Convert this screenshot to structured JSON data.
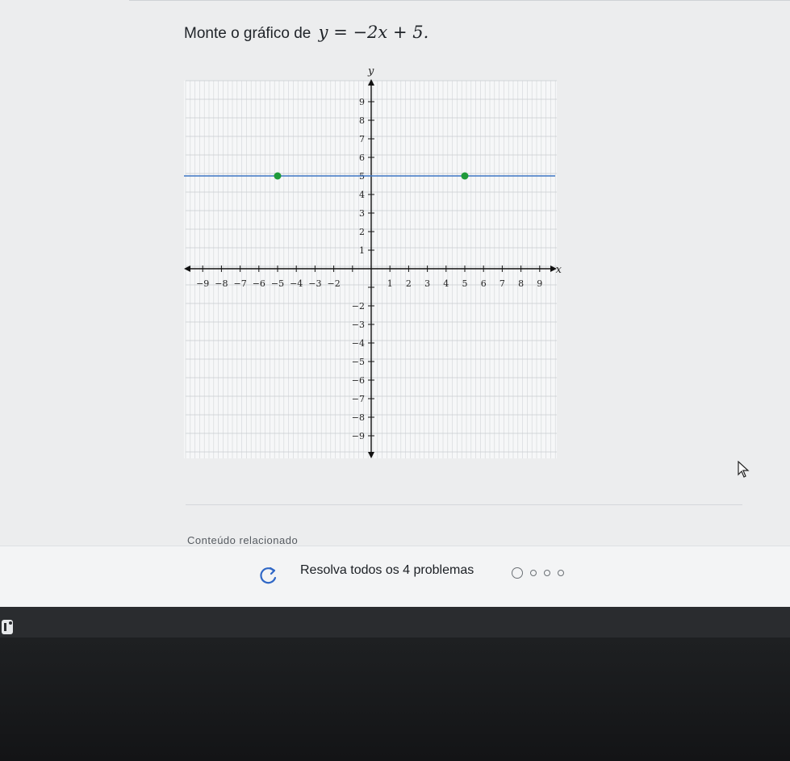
{
  "problem": {
    "prefix": "Monte o gráfico de",
    "equation": "y = −2x + 5."
  },
  "graph": {
    "x_axis_name": "x",
    "y_axis_name": "y",
    "x_ticks": [
      "−9",
      "−8",
      "−7",
      "−6",
      "−5",
      "−4",
      "−3",
      "−2",
      "1",
      "2",
      "3",
      "4",
      "5",
      "6",
      "7",
      "8",
      "9"
    ],
    "y_ticks": [
      "9",
      "8",
      "7",
      "6",
      "5",
      "4",
      "3",
      "2",
      "1",
      "−2",
      "−3",
      "−4",
      "−5",
      "−6",
      "−7",
      "−8",
      "−9"
    ]
  },
  "chart_data": {
    "type": "line",
    "x_range": [
      -10,
      10
    ],
    "y_range": [
      -10,
      10
    ],
    "grid": true,
    "series": [
      {
        "points": [
          [
            -5,
            5
          ],
          [
            5,
            5
          ]
        ],
        "line_color": "#3f76c4",
        "point_color": "#1f9a3a"
      }
    ]
  },
  "related": {
    "label": "Conteúdo relacionado",
    "solve_all": "Resolva todos os 4 problemas",
    "progress_dots": 4
  },
  "icons": {
    "refresh": "refresh-icon",
    "cursor": "cursor-icon",
    "logo": "app-logo-icon"
  },
  "colors": {
    "line": "#3f76c4",
    "points": "#1f9a3a",
    "refresh": "#2f67c6"
  }
}
